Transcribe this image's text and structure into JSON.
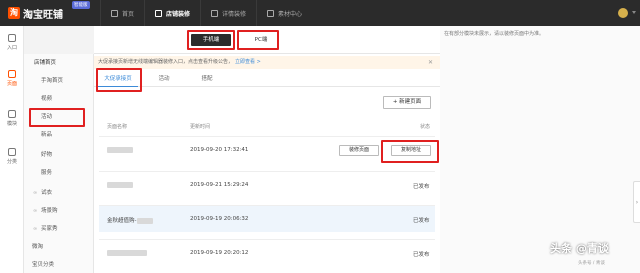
{
  "brand": {
    "logo_char": "淘",
    "name": "淘宝旺铺",
    "badge": "智能版"
  },
  "topnav": [
    {
      "label": "首页",
      "active": false
    },
    {
      "label": "店铺装修",
      "active": true
    },
    {
      "label": "详情装修",
      "active": false
    },
    {
      "label": "素材中心",
      "active": false
    }
  ],
  "leftrail": [
    {
      "label": "入口",
      "icon": "person-icon",
      "active": false
    },
    {
      "label": "页面",
      "icon": "page-icon",
      "active": true
    },
    {
      "label": "模块",
      "icon": "module-icon",
      "active": false
    },
    {
      "label": "分类",
      "icon": "category-icon",
      "active": false
    }
  ],
  "sidemenu": {
    "shop_home": "店铺首页",
    "items": [
      "手淘首页",
      "视频",
      "活动",
      "新品",
      "好物",
      "服务"
    ],
    "groups": [
      "试衣",
      "场景购",
      "买家秀"
    ],
    "weitao": "微淘",
    "baby_category": "宝贝分类"
  },
  "device": {
    "mobile_label": "手机端",
    "pc_label": "PC端"
  },
  "right_note": "在有部分模块未展示，请以装修页面中为准。",
  "notice": {
    "text": "大促承接页新增无线端编辑器装修入口，点击查看升级公告，",
    "link": "立即查看 >"
  },
  "tabs": [
    "大促承接页",
    "活动",
    "搭配"
  ],
  "new_page_button": "+ 新建页面",
  "table": {
    "headers": {
      "name": "页面名称",
      "time": "更新时间",
      "status": "状态"
    },
    "rows": [
      {
        "name": "",
        "time": "2019-09-20 17:32:41",
        "status": "",
        "edit_label": "装修页面",
        "copy_label": "复制地址"
      },
      {
        "name": "",
        "time": "2019-09-21 15:29:24",
        "status": "已发布"
      },
      {
        "name": "金秋超值购-",
        "time": "2019-09-19 20:06:32",
        "status": "已发布"
      },
      {
        "name": "",
        "time": "2019-09-19 20:20:12",
        "status": "已发布"
      }
    ]
  },
  "watermark": {
    "text": "头条 @青谈",
    "sub": "头条号 / 青谈"
  }
}
